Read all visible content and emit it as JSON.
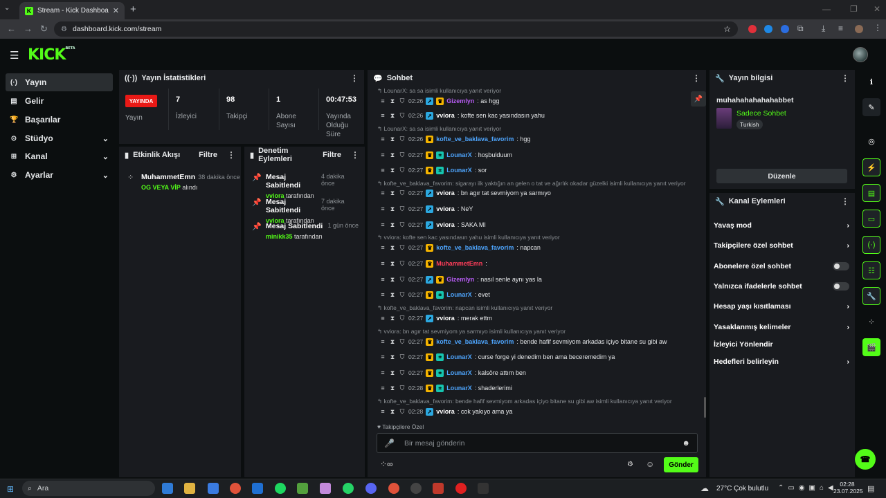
{
  "browser": {
    "tab_title": "Stream - Kick Dashboard",
    "url": "dashboard.kick.com/stream"
  },
  "app": {
    "logo": "KICK",
    "logo_sup": "BETA"
  },
  "sidebar": {
    "items": [
      {
        "label": "Yayın",
        "icon": "broadcast-icon",
        "chevron": false,
        "active": true
      },
      {
        "label": "Gelir",
        "icon": "revenue-icon",
        "chevron": false
      },
      {
        "label": "Başarılar",
        "icon": "trophy-icon",
        "chevron": false
      },
      {
        "label": "Stüdyo",
        "icon": "studio-icon",
        "chevron": true
      },
      {
        "label": "Kanal",
        "icon": "channel-icon",
        "chevron": true
      },
      {
        "label": "Ayarlar",
        "icon": "settings-icon",
        "chevron": true
      }
    ]
  },
  "stats": {
    "title": "Yayın İstatistikleri",
    "live_badge": "YAYINDA",
    "live_label": "Yayın",
    "items": [
      {
        "value": "7",
        "label": "İzleyici"
      },
      {
        "value": "98",
        "label": "Takipçi"
      },
      {
        "value": "1",
        "label": "Abone Sayısı"
      },
      {
        "value": "00:47:53",
        "label": "Yayında Olduğu Süre"
      }
    ]
  },
  "activity": {
    "title": "Etkinlik Akışı",
    "filter": "Filtre",
    "items": [
      {
        "name": "MuhammetEmn",
        "time": "38 dakika önce",
        "highlight": "OG VEYA VİP",
        "suffix": "alındı"
      }
    ]
  },
  "moderation": {
    "title": "Denetim Eylemleri",
    "filter": "Filtre",
    "items": [
      {
        "title": "Mesaj Sabitlendi",
        "time": "4 dakika önce",
        "user": "vviora",
        "suffix": "tarafından"
      },
      {
        "title": "Mesaj Sabitlendi",
        "time": "7 dakika önce",
        "user": "vviora",
        "suffix": "tarafından"
      },
      {
        "title": "Mesaj Sabitlendi",
        "time": "1 gün önce",
        "user": "minikk35",
        "suffix": "tarafından"
      }
    ]
  },
  "chat": {
    "title": "Sohbet",
    "lines": [
      {
        "kind": "reply",
        "text": "LounarX: sa sa  isimli kullanıcıya yanıt veriyor"
      },
      {
        "kind": "msg",
        "ts": "02:26",
        "badges": [
          "blue",
          "gold"
        ],
        "user": "Gizemlyn",
        "color": "#b65cf2",
        "text": ": as hgg"
      },
      {
        "kind": "msg",
        "ts": "02:26",
        "badges": [
          "blue"
        ],
        "user": "vviora",
        "color": "#ffffff",
        "text": ": kofte sen kac yasındasın yahu"
      },
      {
        "kind": "reply",
        "text": "LounarX: sa sa  isimli kullanıcıya yanıt veriyor"
      },
      {
        "kind": "msg",
        "ts": "02:26",
        "badges": [
          "gold"
        ],
        "user": "kofte_ve_baklava_favorim",
        "color": "#4ea6ff",
        "text": ": hgg"
      },
      {
        "kind": "msg",
        "ts": "02:27",
        "badges": [
          "gold",
          "teal"
        ],
        "user": "LounarX",
        "color": "#4ea6ff",
        "text": ": hoşbulduum"
      },
      {
        "kind": "msg",
        "ts": "02:27",
        "badges": [
          "gold",
          "teal"
        ],
        "user": "LounarX",
        "color": "#4ea6ff",
        "text": ": sor"
      },
      {
        "kind": "reply",
        "text": "kofte_ve_baklava_favorim: sigarayı ilk yaktığın an gelen o tat ve ağırlık okadar güzelki isimli kullanıcıya yanıt veriyor"
      },
      {
        "kind": "msg",
        "ts": "02:27",
        "badges": [
          "blue"
        ],
        "user": "vviora",
        "color": "#ffffff",
        "text": ": bn agır tat sevmiyom ya sarmıyo"
      },
      {
        "kind": "msg",
        "ts": "02:27",
        "badges": [
          "blue"
        ],
        "user": "vviora",
        "color": "#ffffff",
        "text": ": NeY"
      },
      {
        "kind": "msg",
        "ts": "02:27",
        "badges": [
          "blue"
        ],
        "user": "vviora",
        "color": "#ffffff",
        "text": ": SAKA MI"
      },
      {
        "kind": "reply",
        "text": "vviora: kofte sen kac yasındasın yahu isimli kullanıcıya yanıt veriyor"
      },
      {
        "kind": "msg",
        "ts": "02:27",
        "badges": [
          "gold"
        ],
        "user": "kofte_ve_baklava_favorim",
        "color": "#4ea6ff",
        "text": ": napcan"
      },
      {
        "kind": "msg",
        "ts": "02:27",
        "badges": [
          "gold"
        ],
        "user": "MuhammetEmn",
        "color": "#ff3d5a",
        "text": ":"
      },
      {
        "kind": "msg",
        "ts": "02:27",
        "badges": [
          "blue",
          "gold"
        ],
        "user": "Gizemlyn",
        "color": "#b65cf2",
        "text": ": nasıl senle aynı yas la"
      },
      {
        "kind": "msg",
        "ts": "02:27",
        "badges": [
          "gold",
          "teal"
        ],
        "user": "LounarX",
        "color": "#4ea6ff",
        "text": ": evet"
      },
      {
        "kind": "reply",
        "text": "kofte_ve_baklava_favorim: napcan isimli kullanıcıya yanıt veriyor"
      },
      {
        "kind": "msg",
        "ts": "02:27",
        "badges": [
          "blue"
        ],
        "user": "vviora",
        "color": "#ffffff",
        "text": ": merak ettm"
      },
      {
        "kind": "reply",
        "text": "vviora: bn agır tat sevmiyom ya sarmıyo isimli kullanıcıya yanıt veriyor"
      },
      {
        "kind": "msg",
        "ts": "02:27",
        "badges": [
          "gold"
        ],
        "user": "kofte_ve_baklava_favorim",
        "color": "#4ea6ff",
        "text": ": bende hafif sevmiyom arkadas içiyo bitane su gibi aw"
      },
      {
        "kind": "msg",
        "ts": "02:27",
        "badges": [
          "gold",
          "teal"
        ],
        "user": "LounarX",
        "color": "#4ea6ff",
        "text": ": curse forge yi denedim ben ama beceremedim ya"
      },
      {
        "kind": "msg",
        "ts": "02:27",
        "badges": [
          "gold",
          "teal"
        ],
        "user": "LounarX",
        "color": "#4ea6ff",
        "text": ": kalsöre attım ben"
      },
      {
        "kind": "msg",
        "ts": "02:28",
        "badges": [
          "gold",
          "teal"
        ],
        "user": "LounarX",
        "color": "#4ea6ff",
        "text": ": shaderlerimi"
      },
      {
        "kind": "reply",
        "text": "kofte_ve_baklava_favorim: bende hafif sevmiyom arkadas içiyo bitane su gibi aw isimli kullanıcıya yanıt veriyor"
      },
      {
        "kind": "msg",
        "ts": "02:28",
        "badges": [
          "blue"
        ],
        "user": "vviora",
        "color": "#ffffff",
        "text": ":       cok yakıyo ama ya"
      }
    ],
    "followers_only": "Takipçilere Özel",
    "input_placeholder": "Bir mesaj gönderin",
    "send": "Gönder"
  },
  "stream_info": {
    "title": "Yayın bilgisi",
    "stream_title": "muhahahahahahabbet",
    "category": "Sadece Sohbet",
    "language": "Turkish",
    "edit": "Düzenle"
  },
  "channel_actions": {
    "title": "Kanal Eylemleri",
    "items": [
      {
        "label": "Yavaş mod",
        "type": "chevron"
      },
      {
        "label": "Takipçilere özel sohbet",
        "type": "chevron"
      },
      {
        "label": "Abonelere özel sohbet",
        "type": "toggle"
      },
      {
        "label": "Yalnızca ifadelerle sohbet",
        "type": "toggle"
      },
      {
        "label": "Hesap yaşı kısıtlaması",
        "type": "chevron"
      },
      {
        "label": "Yasaklanmış kelimeler",
        "type": "chevron"
      },
      {
        "label": "İzleyici Yönlendir",
        "type": "none"
      },
      {
        "label": "Hedefleri belirleyin",
        "type": "chevron"
      }
    ]
  },
  "taskbar": {
    "search": "Ara",
    "weather": "27°C  Çok bulutlu",
    "time": "02:28",
    "date": "23.07.2025"
  }
}
